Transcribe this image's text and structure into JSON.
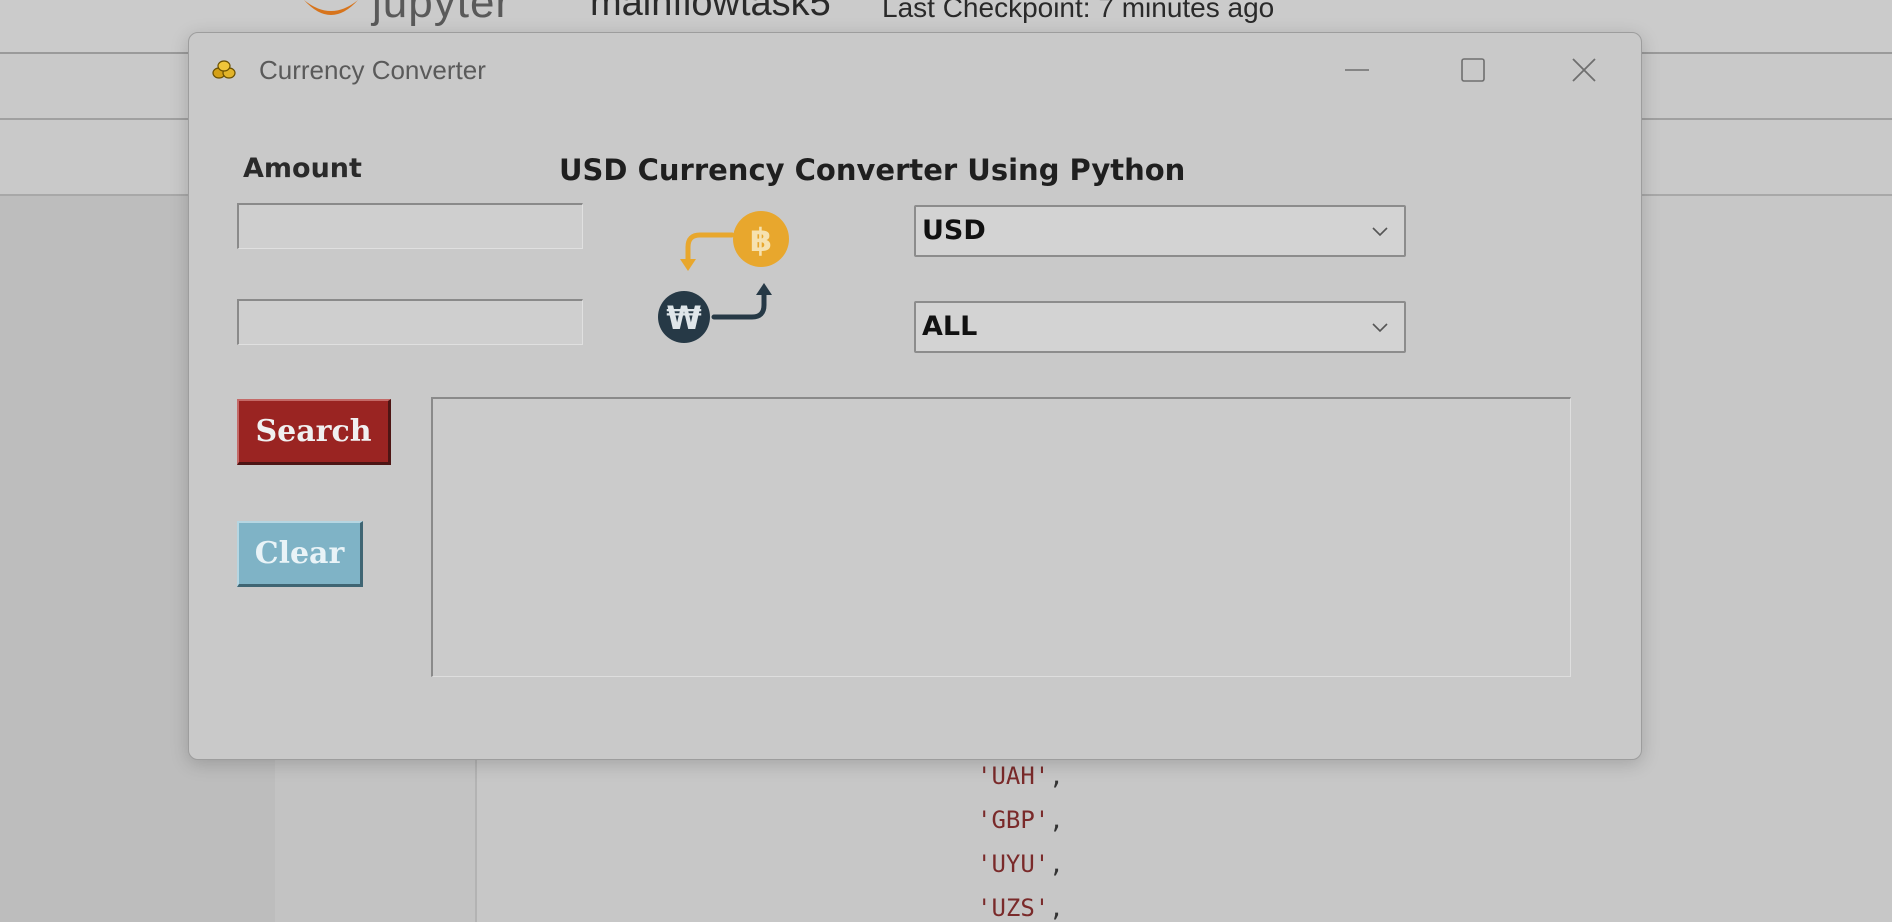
{
  "jupyter": {
    "brand": "jupyter",
    "notebook_name": "mainflowtask5",
    "checkpoint": "Last Checkpoint: 7 minutes ago",
    "code_lines": [
      "'UAH'",
      "'GBP'",
      "'UYU'",
      "'UZS'"
    ],
    "colors": {
      "logo_orange": "#d7741c",
      "string_red": "#7a2a2a"
    }
  },
  "window": {
    "title": "Currency Converter",
    "icons": {
      "app": "coins-icon",
      "minimize": "minimize-icon",
      "maximize": "maximize-icon",
      "close": "close-icon"
    }
  },
  "form": {
    "amount_label": "Amount",
    "heading": "USD Currency Converter Using Python",
    "amount_value": "",
    "result_value": "",
    "from_currency": "USD",
    "to_currency": "ALL",
    "search_label": "Search",
    "clear_label": "Clear",
    "output_text": "",
    "illustration": "currency-exchange-icon",
    "colors": {
      "search_bg": "#9a2422",
      "clear_bg": "#7fb3c6",
      "coin_gold": "#e8a72d",
      "won_dark": "#263946"
    }
  }
}
